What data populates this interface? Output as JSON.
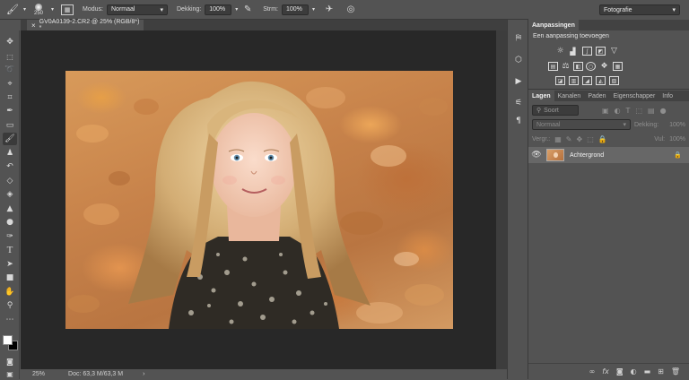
{
  "options_bar": {
    "brush_size": "250",
    "mode_label": "Modus:",
    "mode_value": "Normaal",
    "opacity_label": "Dekking:",
    "opacity_value": "100%",
    "flow_label": "Strm:",
    "flow_value": "100%"
  },
  "workspace": {
    "value": "Fotografie"
  },
  "document": {
    "tab_title": "GV0A0139-2.CR2 @ 25% (RGB/8*) *",
    "close_glyph": "×",
    "zoom": "25%",
    "doc_info": "Doc: 63,3 M/63,3 M",
    "arrow": "›"
  },
  "adjustments": {
    "tab_label": "Aanpassingen",
    "subtitle": "Een aanpassing toevoegen"
  },
  "layers": {
    "tabs": [
      "Lagen",
      "Kanalen",
      "Paden",
      "Eigenschapper",
      "Info"
    ],
    "filter_placeholder": "Soort",
    "blend_mode": "Normaal",
    "opacity_label": "Dekking:",
    "opacity_value": "100%",
    "lock_label": "Vergr.:",
    "fill_label": "Vul:",
    "fill_value": "100%",
    "items": [
      {
        "name": "Achtergrond"
      }
    ]
  },
  "colors": {
    "foreground": "#ffffff",
    "background": "#000000",
    "accent": "#d9a06a"
  }
}
